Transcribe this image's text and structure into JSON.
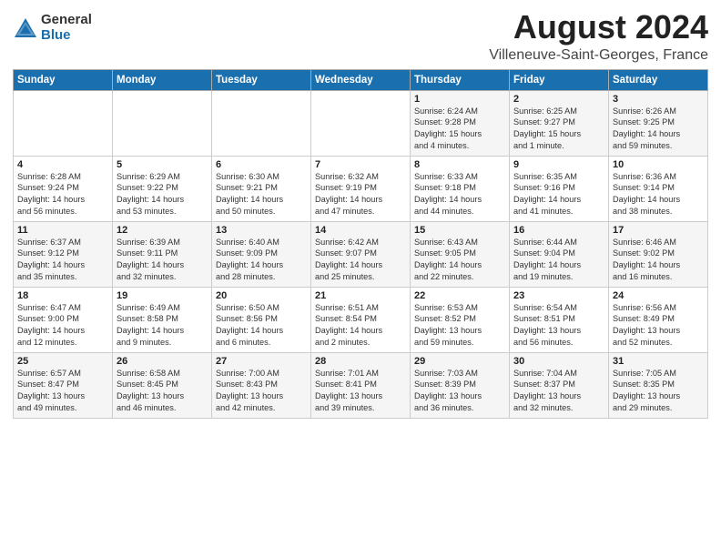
{
  "logo": {
    "general": "General",
    "blue": "Blue"
  },
  "title": "August 2024",
  "location": "Villeneuve-Saint-Georges, France",
  "weekdays": [
    "Sunday",
    "Monday",
    "Tuesday",
    "Wednesday",
    "Thursday",
    "Friday",
    "Saturday"
  ],
  "weeks": [
    [
      {
        "day": "",
        "info": ""
      },
      {
        "day": "",
        "info": ""
      },
      {
        "day": "",
        "info": ""
      },
      {
        "day": "",
        "info": ""
      },
      {
        "day": "1",
        "info": "Sunrise: 6:24 AM\nSunset: 9:28 PM\nDaylight: 15 hours\nand 4 minutes."
      },
      {
        "day": "2",
        "info": "Sunrise: 6:25 AM\nSunset: 9:27 PM\nDaylight: 15 hours\nand 1 minute."
      },
      {
        "day": "3",
        "info": "Sunrise: 6:26 AM\nSunset: 9:25 PM\nDaylight: 14 hours\nand 59 minutes."
      }
    ],
    [
      {
        "day": "4",
        "info": "Sunrise: 6:28 AM\nSunset: 9:24 PM\nDaylight: 14 hours\nand 56 minutes."
      },
      {
        "day": "5",
        "info": "Sunrise: 6:29 AM\nSunset: 9:22 PM\nDaylight: 14 hours\nand 53 minutes."
      },
      {
        "day": "6",
        "info": "Sunrise: 6:30 AM\nSunset: 9:21 PM\nDaylight: 14 hours\nand 50 minutes."
      },
      {
        "day": "7",
        "info": "Sunrise: 6:32 AM\nSunset: 9:19 PM\nDaylight: 14 hours\nand 47 minutes."
      },
      {
        "day": "8",
        "info": "Sunrise: 6:33 AM\nSunset: 9:18 PM\nDaylight: 14 hours\nand 44 minutes."
      },
      {
        "day": "9",
        "info": "Sunrise: 6:35 AM\nSunset: 9:16 PM\nDaylight: 14 hours\nand 41 minutes."
      },
      {
        "day": "10",
        "info": "Sunrise: 6:36 AM\nSunset: 9:14 PM\nDaylight: 14 hours\nand 38 minutes."
      }
    ],
    [
      {
        "day": "11",
        "info": "Sunrise: 6:37 AM\nSunset: 9:12 PM\nDaylight: 14 hours\nand 35 minutes."
      },
      {
        "day": "12",
        "info": "Sunrise: 6:39 AM\nSunset: 9:11 PM\nDaylight: 14 hours\nand 32 minutes."
      },
      {
        "day": "13",
        "info": "Sunrise: 6:40 AM\nSunset: 9:09 PM\nDaylight: 14 hours\nand 28 minutes."
      },
      {
        "day": "14",
        "info": "Sunrise: 6:42 AM\nSunset: 9:07 PM\nDaylight: 14 hours\nand 25 minutes."
      },
      {
        "day": "15",
        "info": "Sunrise: 6:43 AM\nSunset: 9:05 PM\nDaylight: 14 hours\nand 22 minutes."
      },
      {
        "day": "16",
        "info": "Sunrise: 6:44 AM\nSunset: 9:04 PM\nDaylight: 14 hours\nand 19 minutes."
      },
      {
        "day": "17",
        "info": "Sunrise: 6:46 AM\nSunset: 9:02 PM\nDaylight: 14 hours\nand 16 minutes."
      }
    ],
    [
      {
        "day": "18",
        "info": "Sunrise: 6:47 AM\nSunset: 9:00 PM\nDaylight: 14 hours\nand 12 minutes."
      },
      {
        "day": "19",
        "info": "Sunrise: 6:49 AM\nSunset: 8:58 PM\nDaylight: 14 hours\nand 9 minutes."
      },
      {
        "day": "20",
        "info": "Sunrise: 6:50 AM\nSunset: 8:56 PM\nDaylight: 14 hours\nand 6 minutes."
      },
      {
        "day": "21",
        "info": "Sunrise: 6:51 AM\nSunset: 8:54 PM\nDaylight: 14 hours\nand 2 minutes."
      },
      {
        "day": "22",
        "info": "Sunrise: 6:53 AM\nSunset: 8:52 PM\nDaylight: 13 hours\nand 59 minutes."
      },
      {
        "day": "23",
        "info": "Sunrise: 6:54 AM\nSunset: 8:51 PM\nDaylight: 13 hours\nand 56 minutes."
      },
      {
        "day": "24",
        "info": "Sunrise: 6:56 AM\nSunset: 8:49 PM\nDaylight: 13 hours\nand 52 minutes."
      }
    ],
    [
      {
        "day": "25",
        "info": "Sunrise: 6:57 AM\nSunset: 8:47 PM\nDaylight: 13 hours\nand 49 minutes."
      },
      {
        "day": "26",
        "info": "Sunrise: 6:58 AM\nSunset: 8:45 PM\nDaylight: 13 hours\nand 46 minutes."
      },
      {
        "day": "27",
        "info": "Sunrise: 7:00 AM\nSunset: 8:43 PM\nDaylight: 13 hours\nand 42 minutes."
      },
      {
        "day": "28",
        "info": "Sunrise: 7:01 AM\nSunset: 8:41 PM\nDaylight: 13 hours\nand 39 minutes."
      },
      {
        "day": "29",
        "info": "Sunrise: 7:03 AM\nSunset: 8:39 PM\nDaylight: 13 hours\nand 36 minutes."
      },
      {
        "day": "30",
        "info": "Sunrise: 7:04 AM\nSunset: 8:37 PM\nDaylight: 13 hours\nand 32 minutes."
      },
      {
        "day": "31",
        "info": "Sunrise: 7:05 AM\nSunset: 8:35 PM\nDaylight: 13 hours\nand 29 minutes."
      }
    ]
  ]
}
